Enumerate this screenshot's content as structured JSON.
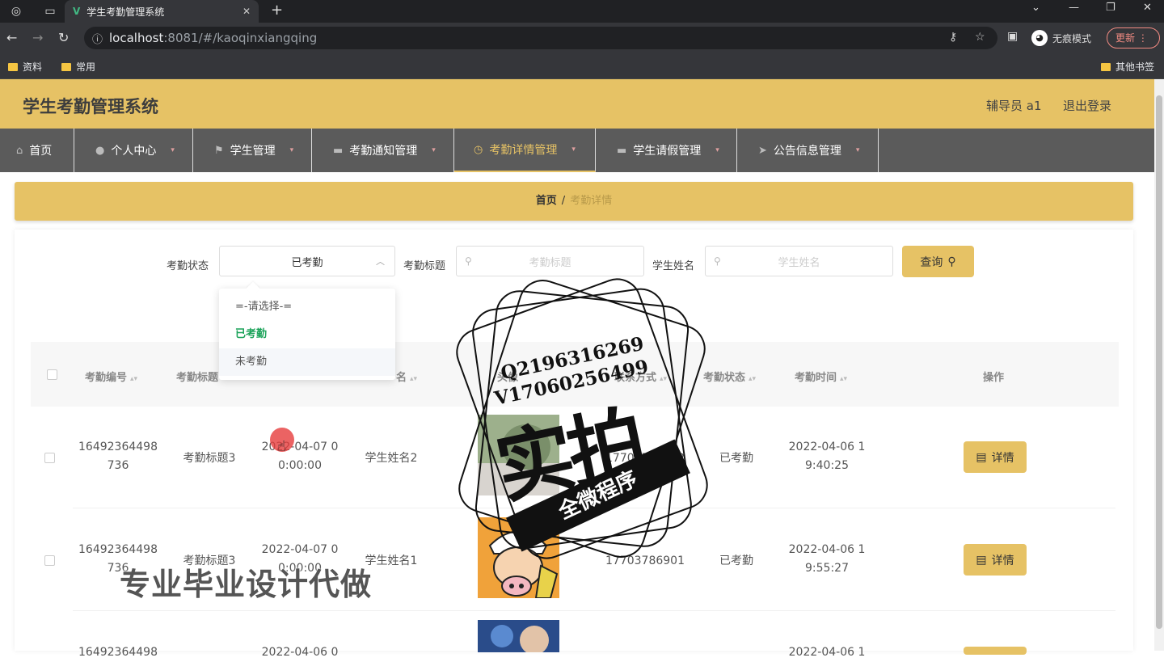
{
  "browser": {
    "tab_title": "学生考勤管理系统",
    "url_host": "localhost",
    "url_rest": ":8081/#/kaoqinxiangqing",
    "incognito_label": "无痕模式",
    "update_label": "更新",
    "bookmarks": [
      "资料",
      "常用"
    ],
    "other_bookmarks": "其他书签"
  },
  "header": {
    "title": "学生考勤管理系统",
    "user": "辅导员 a1",
    "logout": "退出登录"
  },
  "nav": {
    "items": [
      {
        "label": "首页"
      },
      {
        "label": "个人中心"
      },
      {
        "label": "学生管理"
      },
      {
        "label": "考勤通知管理"
      },
      {
        "label": "考勤详情管理"
      },
      {
        "label": "学生请假管理"
      },
      {
        "label": "公告信息管理"
      }
    ]
  },
  "breadcrumb": {
    "home": "首页",
    "sep": "/",
    "current": "考勤详情"
  },
  "filters": {
    "status_label": "考勤状态",
    "status_value": "已考勤",
    "title_label": "考勤标题",
    "title_placeholder": "考勤标题",
    "name_label": "学生姓名",
    "name_placeholder": "学生姓名",
    "query_label": "查询"
  },
  "dropdown": {
    "options": [
      "=-请选择-=",
      "已考勤",
      "未考勤"
    ]
  },
  "table": {
    "headers": [
      "考勤编号",
      "考勤标题",
      "",
      "学生姓名",
      "头像",
      "联系方式",
      "考勤状态",
      "考勤时间",
      "操作"
    ],
    "header_visible": [
      "考勤编号",
      "考勤标题",
      "名",
      "头像",
      "联系方式",
      "考勤状态",
      "考勤时间",
      "操作"
    ],
    "rows": [
      {
        "id1": "16492364498",
        "id2": "736",
        "title": "考勤标题3",
        "date1": "2022-04-07 0",
        "date2": "0:00:00",
        "name": "学生姓名2",
        "phone": "17703786902",
        "status": "已考勤",
        "time1": "2022-04-06 1",
        "time2": "9:40:25",
        "action": "详情"
      },
      {
        "id1": "16492364498",
        "id2": "736",
        "title": "考勤标题3",
        "date1": "2022-04-07 0",
        "date2": "0:00:00",
        "name": "学生姓名1",
        "phone": "17703786901",
        "status": "已考勤",
        "time1": "2022-04-06 1",
        "time2": "9:55:27",
        "action": "详情"
      },
      {
        "id1": "16492364498",
        "date1": "2022-04-06 0",
        "time1": "2022-04-06 1"
      }
    ]
  },
  "overlay": {
    "stamp_qq": "Q2196316269",
    "stamp_v": "V17060256499",
    "stamp_big": "实拍",
    "stamp_ribbon": "全微程序",
    "watermark": "专业毕业设计代做"
  },
  "colors": {
    "accent": "#e6c265",
    "nav_bg": "#5b5b5b",
    "selected_option": "#1ca35a"
  }
}
